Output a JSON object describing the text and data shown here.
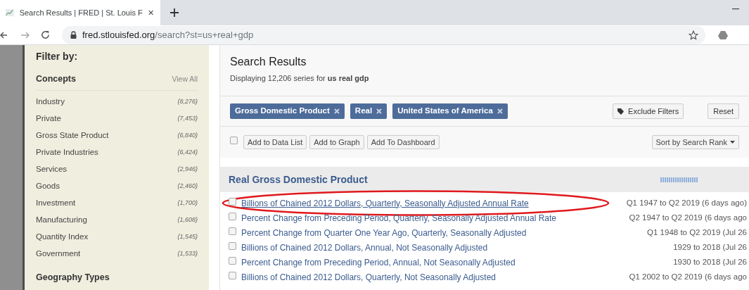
{
  "browser": {
    "tab_title": "Search Results | FRED | St. Louis F",
    "url_host": "fred.stlouisfed.org",
    "url_path": "/search?st=us+real+gdp"
  },
  "sidebar": {
    "title": "Filter by:",
    "section": "Concepts",
    "view_all": "View All",
    "items": [
      {
        "label": "Industry",
        "count": "(8,276)"
      },
      {
        "label": "Private",
        "count": "(7,453)"
      },
      {
        "label": "Gross State Product",
        "count": "(6,840)"
      },
      {
        "label": "Private Industries",
        "count": "(6,424)"
      },
      {
        "label": "Services",
        "count": "(2,946)"
      },
      {
        "label": "Goods",
        "count": "(2,460)"
      },
      {
        "label": "Investment",
        "count": "(1,700)"
      },
      {
        "label": "Manufacturing",
        "count": "(1,608)"
      },
      {
        "label": "Quantity Index",
        "count": "(1,545)"
      },
      {
        "label": "Government",
        "count": "(1,533)"
      }
    ],
    "next_section": "Geography Types"
  },
  "results": {
    "title": "Search Results",
    "summary": "Displaying 12,206 series for **us real gdp**",
    "filters": [
      "Gross Domestic Product",
      "Real",
      "United States of America"
    ],
    "exclude_button": "Exclude Filters",
    "reset_button": "Reset",
    "select_all_checked": false,
    "actions": [
      "Add to Data List",
      "Add to Graph",
      "Add To Dashboard"
    ],
    "sort": "Sort by Search Rank",
    "group_title": "Real Gross Domestic Product",
    "series": [
      {
        "title": "Billions of Chained 2012 Dollars, Quarterly, Seasonally Adjusted Annual Rate",
        "range": "Q1 1947 to Q2 2019 (6 days ago)",
        "checked": false,
        "highlighted": true
      },
      {
        "title": "Percent Change from Preceding Period, Quarterly, Seasonally Adjusted Annual Rate",
        "range": "Q2 1947 to Q2 2019 (6 days ago",
        "checked": false,
        "highlighted": false
      },
      {
        "title": "Percent Change from Quarter One Year Ago, Quarterly, Seasonally Adjusted",
        "range": "Q1 1948 to Q2 2019 (Jul 26",
        "checked": false,
        "highlighted": false
      },
      {
        "title": "Billions of Chained 2012 Dollars, Annual, Not Seasonally Adjusted",
        "range": "1929 to 2018 (Jul 26",
        "checked": false,
        "highlighted": false
      },
      {
        "title": "Percent Change from Preceding Period, Annual, Not Seasonally Adjusted",
        "range": "1930 to 2018 (Jul 26",
        "checked": false,
        "highlighted": false
      },
      {
        "title": "Billions of Chained 2012 Dollars, Quarterly, Not Seasonally Adjusted",
        "range": "Q1 2002 to Q2 2019 (6 days ago",
        "checked": false,
        "highlighted": false
      }
    ]
  }
}
